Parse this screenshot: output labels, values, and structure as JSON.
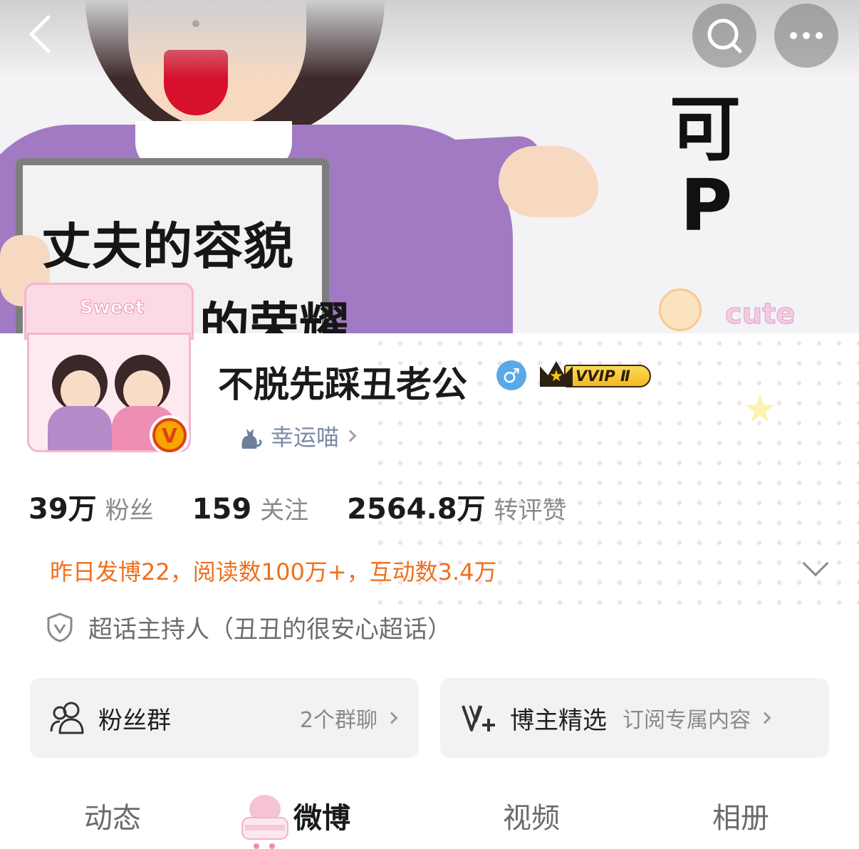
{
  "banner": {
    "sign_text_line1": "丈夫的容貌",
    "sign_text_line2": "的荣耀",
    "side_text_1": "可",
    "side_text_2": "P",
    "sticker_text": "cute",
    "frame_text": "Sweet"
  },
  "nav": {
    "back_icon": "back-chevron-icon",
    "search_icon": "search-icon",
    "more_icon": "more-dots-icon"
  },
  "profile": {
    "nickname": "不脱先踩丑老公",
    "gender_symbol": "♂",
    "vip_label": "VVIP Ⅱ",
    "lucky_label": "幸运喵",
    "verified_mark": "V"
  },
  "stats": [
    {
      "value": "39万",
      "label": "粉丝"
    },
    {
      "value": "159",
      "label": "关注"
    },
    {
      "value": "2564.8万",
      "label": "转评赞"
    }
  ],
  "data_summary": "昨日发博22，阅读数100万+，互动数3.4万",
  "host_role": "超话主持人（丑丑的很安心超话）",
  "cards": {
    "fans_group": {
      "title": "粉丝群",
      "sub": "2个群聊"
    },
    "selection": {
      "title": "博主精选",
      "sub": "订阅专属内容"
    }
  },
  "tabs": [
    {
      "label": "动态"
    },
    {
      "label": "微博"
    },
    {
      "label": "视频"
    },
    {
      "label": "相册"
    }
  ],
  "colors": {
    "accent_orange": "#ef6f1d",
    "gender_blue": "#5aa8e6",
    "vip_gold": "#f3b722"
  }
}
